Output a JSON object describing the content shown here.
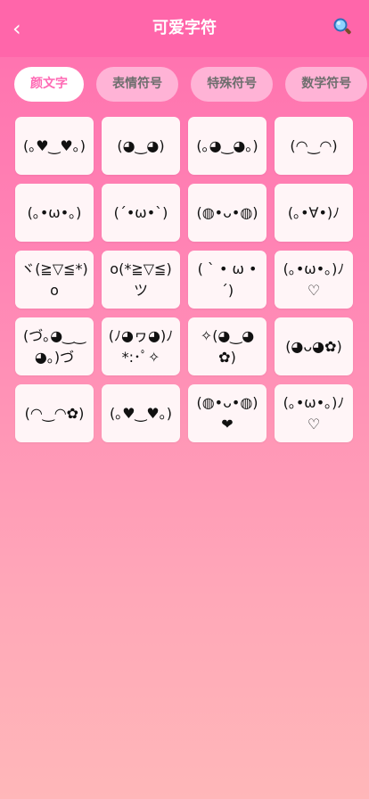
{
  "header": {
    "back_label": "‹",
    "title": "可爱字符",
    "search_icon": "search-icon"
  },
  "tabs": [
    {
      "label": "颜文字",
      "active": true
    },
    {
      "label": "表情符号",
      "active": false
    },
    {
      "label": "特殊符号",
      "active": false
    },
    {
      "label": "数学符号",
      "active": false
    }
  ],
  "kaomoji": [
    "(｡♥‿♥｡)",
    "(◕‿◕)",
    "(｡◕‿◕｡)",
    "(◠‿◠)",
    "(｡•ω•｡)",
    "(´•ω•`)",
    "(◍•ᴗ•◍)",
    "(｡•∀•)ﾉ",
    "ヾ(≧▽≦*)o",
    "o(*≧▽≦)ツ",
    "( ` • ω • ´)",
    "(｡•ω•｡)ﾉ♡",
    "(づ｡◕‿‿◕｡)づ",
    "(ﾉ◕ヮ◕)ﾉ*:･ﾟ✧",
    "✧(◕‿◕✿)",
    "(◕ᴗ◕✿)",
    "(◠‿◠✿)",
    "(｡♥‿♥｡)",
    "(◍•ᴗ•◍)❤",
    "(｡•ω•｡)ﾉ♡"
  ],
  "colors": {
    "header": "#ff66aa",
    "active_tab_text": "#ff69b4",
    "tab_bg": "#ffb3d6",
    "card_bg": "#fff5f7"
  }
}
